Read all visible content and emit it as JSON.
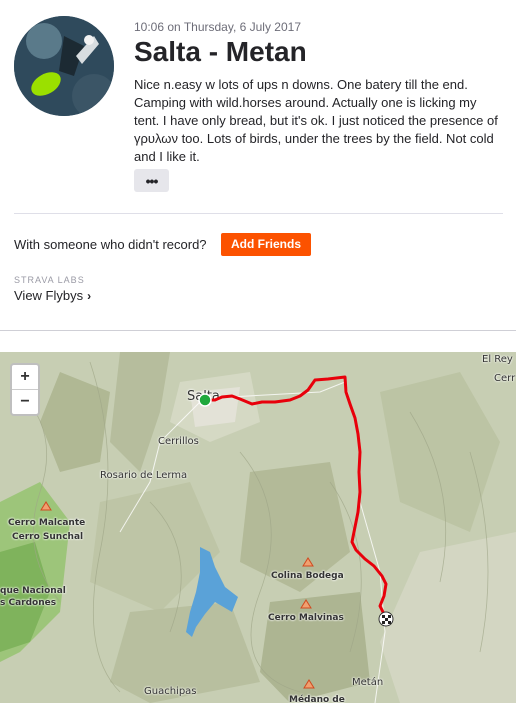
{
  "activity": {
    "timestamp": "10:06 on Thursday, 6 July 2017",
    "title": "Salta - Metan",
    "description": "Nice n.easy w lots of ups n downs. One batery till the end. Camping with wild.horses around. Actually one is licking my tent. I have only bread, but it's ok. I just noticed the presence of γρυλων too. Lots of birds, under the trees by the field. Not cold and I like it.",
    "more_label": "•••"
  },
  "friends": {
    "prompt": "With someone who didn't record?",
    "add_label": "Add Friends"
  },
  "labs": {
    "section_label": "STRAVA LABS",
    "flybys_label": "View Flybys",
    "chevron": "›"
  },
  "map": {
    "zoom_in": "+",
    "zoom_out": "−",
    "labels": {
      "salta": "Salta",
      "cerrillos": "Cerrillos",
      "rosario": "Rosario de Lerma",
      "malcante": "Cerro Malcante",
      "sunchal": "Cerro Sunchal",
      "parque": "que Nacional",
      "cardones": "s Cardones",
      "colina": "Colina Bodega",
      "malvinas": "Cerro Malvinas",
      "guachipas": "Guachipas",
      "medano": "Médano de",
      "metan": "Metán",
      "elrey": "El Rey",
      "cerr": "Cerr"
    },
    "route_color": "#e8000b",
    "start_color": "#1fa83c"
  }
}
